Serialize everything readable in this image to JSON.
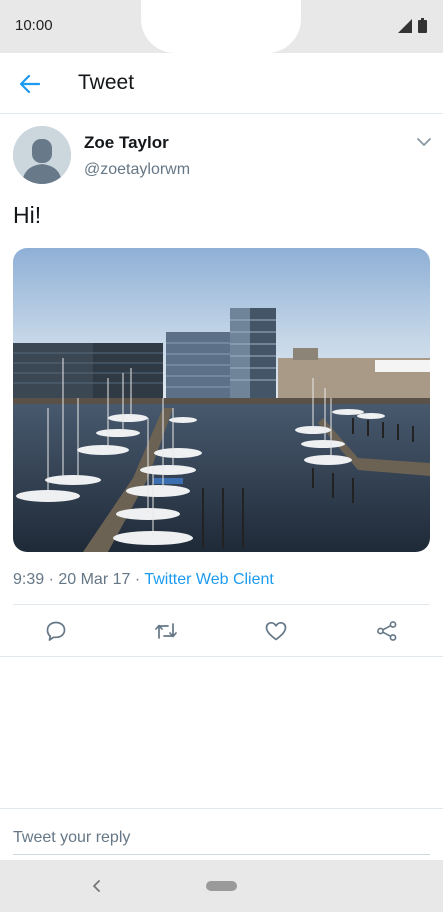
{
  "status_bar": {
    "time": "10:00"
  },
  "header": {
    "title": "Tweet"
  },
  "tweet": {
    "name": "Zoe Taylor",
    "handle": "@zoetaylorwm",
    "text": "Hi!",
    "time_date": "9:39 · 20 Mar 17 · ",
    "client": "Twitter Web Client"
  },
  "reply": {
    "placeholder": "Tweet your reply"
  },
  "colors": {
    "accent": "#1d9bf0",
    "secondary_text": "#657786",
    "divider": "#e1e8ed"
  },
  "icons": [
    "back-arrow-icon",
    "chevron-down-icon",
    "reply-icon",
    "retweet-icon",
    "like-icon",
    "share-icon",
    "signal-icon",
    "battery-icon",
    "nav-back-icon"
  ]
}
